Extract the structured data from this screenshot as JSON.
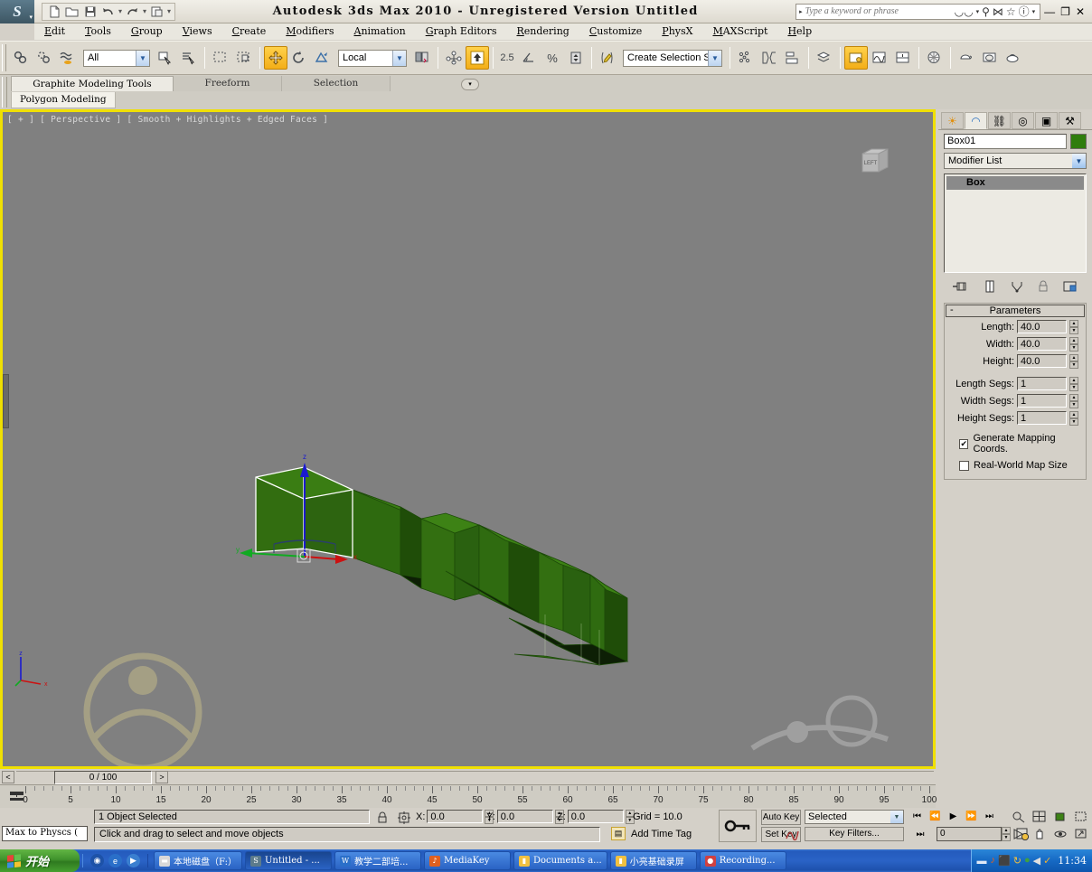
{
  "window": {
    "app_title": "Autodesk 3ds Max  2010  -  Unregistered Version  Untitled",
    "logo_glyph": "S",
    "minimize": "—",
    "restore": "❐",
    "close": "✕"
  },
  "quick_access": {
    "items": [
      {
        "name": "new-file-icon",
        "glyph": "▢"
      },
      {
        "name": "open-file-icon",
        "glyph": "▱"
      },
      {
        "name": "save-file-icon",
        "glyph": "▣"
      },
      {
        "name": "undo-icon",
        "glyph": "↶"
      },
      {
        "name": "undo-dropdown-icon",
        "glyph": "▾"
      },
      {
        "name": "redo-icon",
        "glyph": "↷"
      },
      {
        "name": "redo-dropdown-icon",
        "glyph": "▾"
      },
      {
        "name": "project-folder-icon",
        "glyph": "▥"
      },
      {
        "name": "qat-dropdown-icon",
        "glyph": "▾"
      }
    ]
  },
  "search": {
    "placeholder": "Type a keyword or phrase",
    "expand_glyph": "▸",
    "icons": [
      {
        "name": "binoculars-icon",
        "glyph": "ΘΘ"
      },
      {
        "name": "binoculars-dropdown-icon",
        "glyph": "▾"
      },
      {
        "name": "key-icon",
        "glyph": "⚷"
      },
      {
        "name": "satellite-icon",
        "glyph": "⋈"
      },
      {
        "name": "favorites-star-icon",
        "glyph": "☆"
      },
      {
        "name": "help-icon",
        "glyph": "ⓘ"
      },
      {
        "name": "help-dropdown-icon",
        "glyph": "▾"
      }
    ]
  },
  "menu": {
    "items": [
      "Edit",
      "Tools",
      "Group",
      "Views",
      "Create",
      "Modifiers",
      "Animation",
      "Graph Editors",
      "Rendering",
      "Customize",
      "PhysX",
      "MAXScript",
      "Help"
    ]
  },
  "toolbar": {
    "selection_filter": "All",
    "reference_coord": "Local",
    "named_selection_sets": "Create Selection Set",
    "angle_snap_value": "2.5",
    "buttons": [
      {
        "name": "select-and-link-icon",
        "glyph": "⚭",
        "active": false
      },
      {
        "name": "unlink-selection-icon",
        "glyph": "⚮",
        "active": false
      },
      {
        "name": "bind-to-space-warp-icon",
        "glyph": "≈",
        "active": false
      },
      {
        "name": "select-object-icon",
        "glyph": "⬚",
        "active": false
      },
      {
        "name": "select-by-name-icon",
        "glyph": "☰",
        "active": false
      },
      {
        "name": "rectangular-selection-region-icon",
        "glyph": "⬚",
        "active": false
      },
      {
        "name": "window-crossing-icon",
        "glyph": "⬛",
        "active": false
      },
      {
        "name": "select-and-move-icon",
        "glyph": "✥",
        "active": true
      },
      {
        "name": "select-and-rotate-icon",
        "glyph": "↻",
        "active": false
      },
      {
        "name": "select-and-scale-icon",
        "glyph": "◤",
        "active": false
      },
      {
        "name": "use-pivot-point-center-icon",
        "glyph": "⧉",
        "active": false
      },
      {
        "name": "select-and-manipulate-icon",
        "glyph": "⑂",
        "active": false
      },
      {
        "name": "snaps-toggle-icon",
        "glyph": "⬆",
        "active": true
      },
      {
        "name": "angle-snap-toggle-icon",
        "glyph": "∠",
        "active": false
      },
      {
        "name": "percent-snap-toggle-icon",
        "glyph": "%",
        "active": false
      },
      {
        "name": "spinner-snap-toggle-icon",
        "glyph": "↕",
        "active": false
      },
      {
        "name": "edit-named-selection-sets-icon",
        "glyph": "✎",
        "active": false
      },
      {
        "name": "mirror-icon",
        "glyph": "⁘",
        "active": false
      },
      {
        "name": "align-icon",
        "glyph": "⎇",
        "active": false
      },
      {
        "name": "layer-manager-icon",
        "glyph": "☰",
        "active": false
      },
      {
        "name": "graphite-modeling-toolbar-icon",
        "glyph": "▤",
        "active": false
      },
      {
        "name": "curve-editor-icon",
        "glyph": "◰",
        "active": true
      },
      {
        "name": "schematic-view-icon",
        "glyph": "▥",
        "active": false
      },
      {
        "name": "material-editor-icon",
        "glyph": "◍",
        "active": false
      },
      {
        "name": "render-setup-icon",
        "glyph": "☖",
        "active": false
      },
      {
        "name": "render-frame-window-icon",
        "glyph": "◔",
        "active": false
      },
      {
        "name": "render-production-icon",
        "glyph": "◔",
        "active": false
      }
    ]
  },
  "ribbon": {
    "tabs": [
      {
        "label": "Graphite Modeling Tools",
        "active": true
      },
      {
        "label": "Freeform",
        "active": false
      },
      {
        "label": "Selection",
        "active": false
      }
    ],
    "panel": "Polygon Modeling",
    "dropdown_glyph": "▾"
  },
  "viewport": {
    "label": "[ + ] [ Perspective ] [ Smooth + Highlights + Edged Faces ]",
    "background": "#808080",
    "active_border": "#f0e000",
    "viewcube_face": "LEFT",
    "axis": {
      "x": "x",
      "y": "y",
      "z": "z"
    },
    "object_color": "#2f7d0d"
  },
  "command_panel": {
    "tabs": [
      {
        "name": "create-tab",
        "glyph": "☀",
        "selected": false
      },
      {
        "name": "modify-tab",
        "glyph": "◠",
        "selected": true
      },
      {
        "name": "hierarchy-tab",
        "glyph": "⛓",
        "selected": false
      },
      {
        "name": "motion-tab",
        "glyph": "◎",
        "selected": false
      },
      {
        "name": "display-tab",
        "glyph": "▣",
        "selected": false
      },
      {
        "name": "utilities-tab",
        "glyph": "⚒",
        "selected": false
      }
    ],
    "object_name": "Box01",
    "object_color": "#2f7d0d",
    "modifier_list_label": "Modifier List",
    "modifier_stack": [
      "Box"
    ],
    "stack_buttons": [
      {
        "name": "pin-stack-icon",
        "glyph": "⊣■"
      },
      {
        "name": "show-end-result-icon",
        "glyph": "‖"
      },
      {
        "name": "make-unique-icon",
        "glyph": "⑂"
      },
      {
        "name": "remove-modifier-icon",
        "glyph": "☂"
      },
      {
        "name": "configure-modifier-sets-icon",
        "glyph": "▤"
      }
    ],
    "parameters": {
      "title": "Parameters",
      "collapse_glyph": "-",
      "fields": [
        {
          "label": "Length:",
          "value": "40.0"
        },
        {
          "label": "Width:",
          "value": "40.0"
        },
        {
          "label": "Height:",
          "value": "40.0"
        }
      ],
      "segs": [
        {
          "label": "Length Segs:",
          "value": "1"
        },
        {
          "label": "Width Segs:",
          "value": "1"
        },
        {
          "label": "Height Segs:",
          "value": "1"
        }
      ],
      "checkboxes": [
        {
          "label": "Generate Mapping Coords.",
          "checked": true
        },
        {
          "label": "Real-World Map Size",
          "checked": false
        }
      ]
    }
  },
  "time_slider": {
    "value": "0 / 100",
    "prev_glyph": "<",
    "next_glyph": ">",
    "ruler_labels": [
      "0",
      "5",
      "10",
      "15",
      "20",
      "25",
      "30",
      "35",
      "40",
      "45",
      "50",
      "55",
      "60",
      "65",
      "70",
      "75",
      "80",
      "85",
      "90",
      "95",
      "100"
    ]
  },
  "status_bar": {
    "max_to_physx": "Max to Physcs (",
    "selection_status": "1 Object Selected",
    "prompt": "Click and drag to select and move objects",
    "lock_icon": "⚿",
    "coord_icon": "⬚",
    "coords": [
      {
        "label": "X:",
        "value": "0.0"
      },
      {
        "label": "Y:",
        "value": "0.0"
      },
      {
        "label": "Z:",
        "value": "0.0"
      }
    ],
    "grid": "Grid = 10.0",
    "add_time_tag": "Add Time Tag"
  },
  "animation": {
    "key_mode_icon": "⚷",
    "auto_key": "Auto Key",
    "set_key": "Set Key",
    "key_filter_selection": "Selected",
    "key_filters": "Key Filters...",
    "frame_value": "0",
    "transport": [
      {
        "name": "go-to-start-icon",
        "glyph": "⏮"
      },
      {
        "name": "previous-frame-icon",
        "glyph": "⏪"
      },
      {
        "name": "play-animation-icon",
        "glyph": "▶"
      },
      {
        "name": "next-frame-icon",
        "glyph": "⏩"
      },
      {
        "name": "go-to-end-icon",
        "glyph": "⏭"
      }
    ],
    "nav_buttons": [
      {
        "name": "zoom-icon",
        "glyph": "⚲"
      },
      {
        "name": "zoom-all-icon",
        "glyph": "⊞"
      },
      {
        "name": "zoom-extents-icon",
        "glyph": "⬛"
      },
      {
        "name": "zoom-region-icon",
        "glyph": "⬚"
      },
      {
        "name": "key-mode-toggle-icon",
        "glyph": "⏭"
      },
      {
        "name": "time-configuration-icon",
        "glyph": "⏱"
      },
      {
        "name": "field-of-view-icon",
        "glyph": "▷"
      },
      {
        "name": "pan-view-icon",
        "glyph": "✋"
      },
      {
        "name": "orbit-icon",
        "glyph": "⤭"
      },
      {
        "name": "maximize-viewport-icon",
        "glyph": "⤡"
      }
    ]
  },
  "taskbar": {
    "start_label": "开始",
    "quick_launch": [
      {
        "name": "show-desktop-icon",
        "glyph": "◉",
        "color": "#1d52a8"
      },
      {
        "name": "internet-explorer-icon",
        "glyph": "e",
        "color": "#2a6fc9"
      },
      {
        "name": "media-player-icon",
        "glyph": "▶",
        "color": "#3a7fd0"
      }
    ],
    "tasks": [
      {
        "label": "本地磁盘（F:）",
        "icon_color": "#d8d8d8",
        "glyph": "▬",
        "active": false
      },
      {
        "label": "Untitled - ...",
        "icon_color": "#5c7b8c",
        "glyph": "S",
        "active": true
      },
      {
        "label": "教学二部培...",
        "icon_color": "#2a6fc9",
        "glyph": "W",
        "active": false
      },
      {
        "label": "MediaKey",
        "icon_color": "#e06020",
        "glyph": "♪",
        "active": false
      },
      {
        "label": "Documents a...",
        "icon_color": "#f0c040",
        "glyph": "▮",
        "active": false
      },
      {
        "label": "小亮基础录屏",
        "icon_color": "#f0c040",
        "glyph": "▮",
        "active": false
      },
      {
        "label": "Recording...",
        "icon_color": "#d04040",
        "glyph": "●",
        "active": false
      }
    ],
    "tray": [
      {
        "name": "tray-media-icon",
        "glyph": "♪",
        "color": "#e06020"
      },
      {
        "name": "tray-network-icon",
        "glyph": "⬛",
        "color": "#4a7ad0"
      },
      {
        "name": "tray-update-icon",
        "glyph": "↻",
        "color": "#f0c040"
      },
      {
        "name": "tray-shield-icon",
        "glyph": "●",
        "color": "#40a040"
      },
      {
        "name": "tray-volume-icon",
        "glyph": "◀",
        "color": "#e0e0e0"
      },
      {
        "name": "tray-security-icon",
        "glyph": "✓",
        "color": "#f0b030"
      }
    ],
    "show_hidden_glyph": "▬",
    "clock": "11:34"
  }
}
